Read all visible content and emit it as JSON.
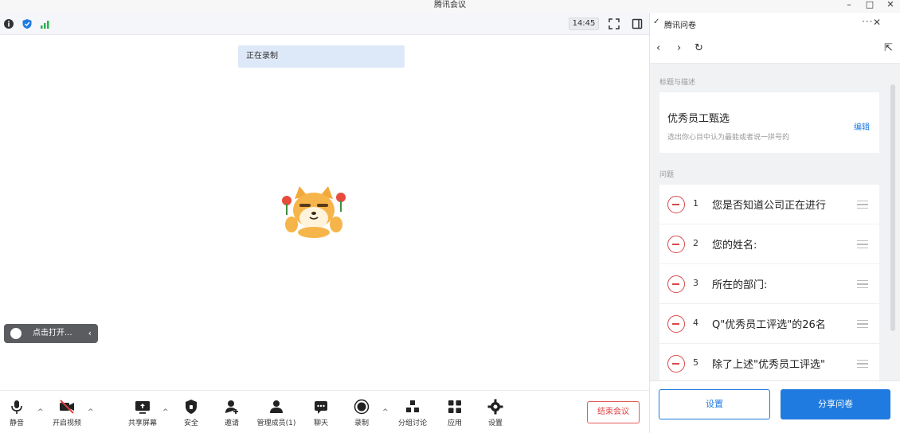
{
  "window": {
    "title": "腾讯会议",
    "minimize": "–",
    "maximize": "□",
    "close": "✕"
  },
  "top_strip": {
    "time": "14:45"
  },
  "stage": {
    "recording_banner": "正在录制",
    "side_pill_text": "点击打开...",
    "side_pill_chevron": "‹"
  },
  "toolbar": {
    "items": [
      {
        "label": "静音",
        "icon": "microphone-icon"
      },
      {
        "label": "开启视频",
        "icon": "video-off-icon"
      },
      {
        "label": "共享屏幕",
        "icon": "screen-share-icon"
      },
      {
        "label": "安全",
        "icon": "shield-icon"
      },
      {
        "label": "邀请",
        "icon": "invite-icon"
      },
      {
        "label": "管理成员(1)",
        "icon": "members-icon"
      },
      {
        "label": "聊天",
        "icon": "chat-icon"
      },
      {
        "label": "录制",
        "icon": "record-icon"
      },
      {
        "label": "分组讨论",
        "icon": "breakout-icon"
      },
      {
        "label": "应用",
        "icon": "apps-icon"
      },
      {
        "label": "设置",
        "icon": "gear-icon"
      }
    ],
    "caret": "^",
    "end_meeting": "结束会议"
  },
  "panel": {
    "title": "腾讯问卷",
    "more": "···",
    "close": "✕",
    "nav": {
      "back": "‹",
      "forward": "›",
      "refresh": "↻",
      "expand": "⇱"
    },
    "section_title_label": "标题与描述",
    "survey_title": "优秀员工甄选",
    "survey_desc": "选出你心目中认为最能或者说一拼号的",
    "edit_label": "编辑",
    "section_questions_label": "问题",
    "questions": [
      {
        "num": "1",
        "text": "您是否知道公司正在进行"
      },
      {
        "num": "2",
        "text": "您的姓名:"
      },
      {
        "num": "3",
        "text": "所在的部门:"
      },
      {
        "num": "4",
        "text": "Q\"优秀员工评选\"的26名"
      },
      {
        "num": "5",
        "text": "除了上述\"优秀员工评选\""
      }
    ],
    "settings_button": "设置",
    "share_button": "分享问卷"
  },
  "colors": {
    "accent": "#1f7be0",
    "danger": "#d94848",
    "banner": "#dde8f8"
  }
}
